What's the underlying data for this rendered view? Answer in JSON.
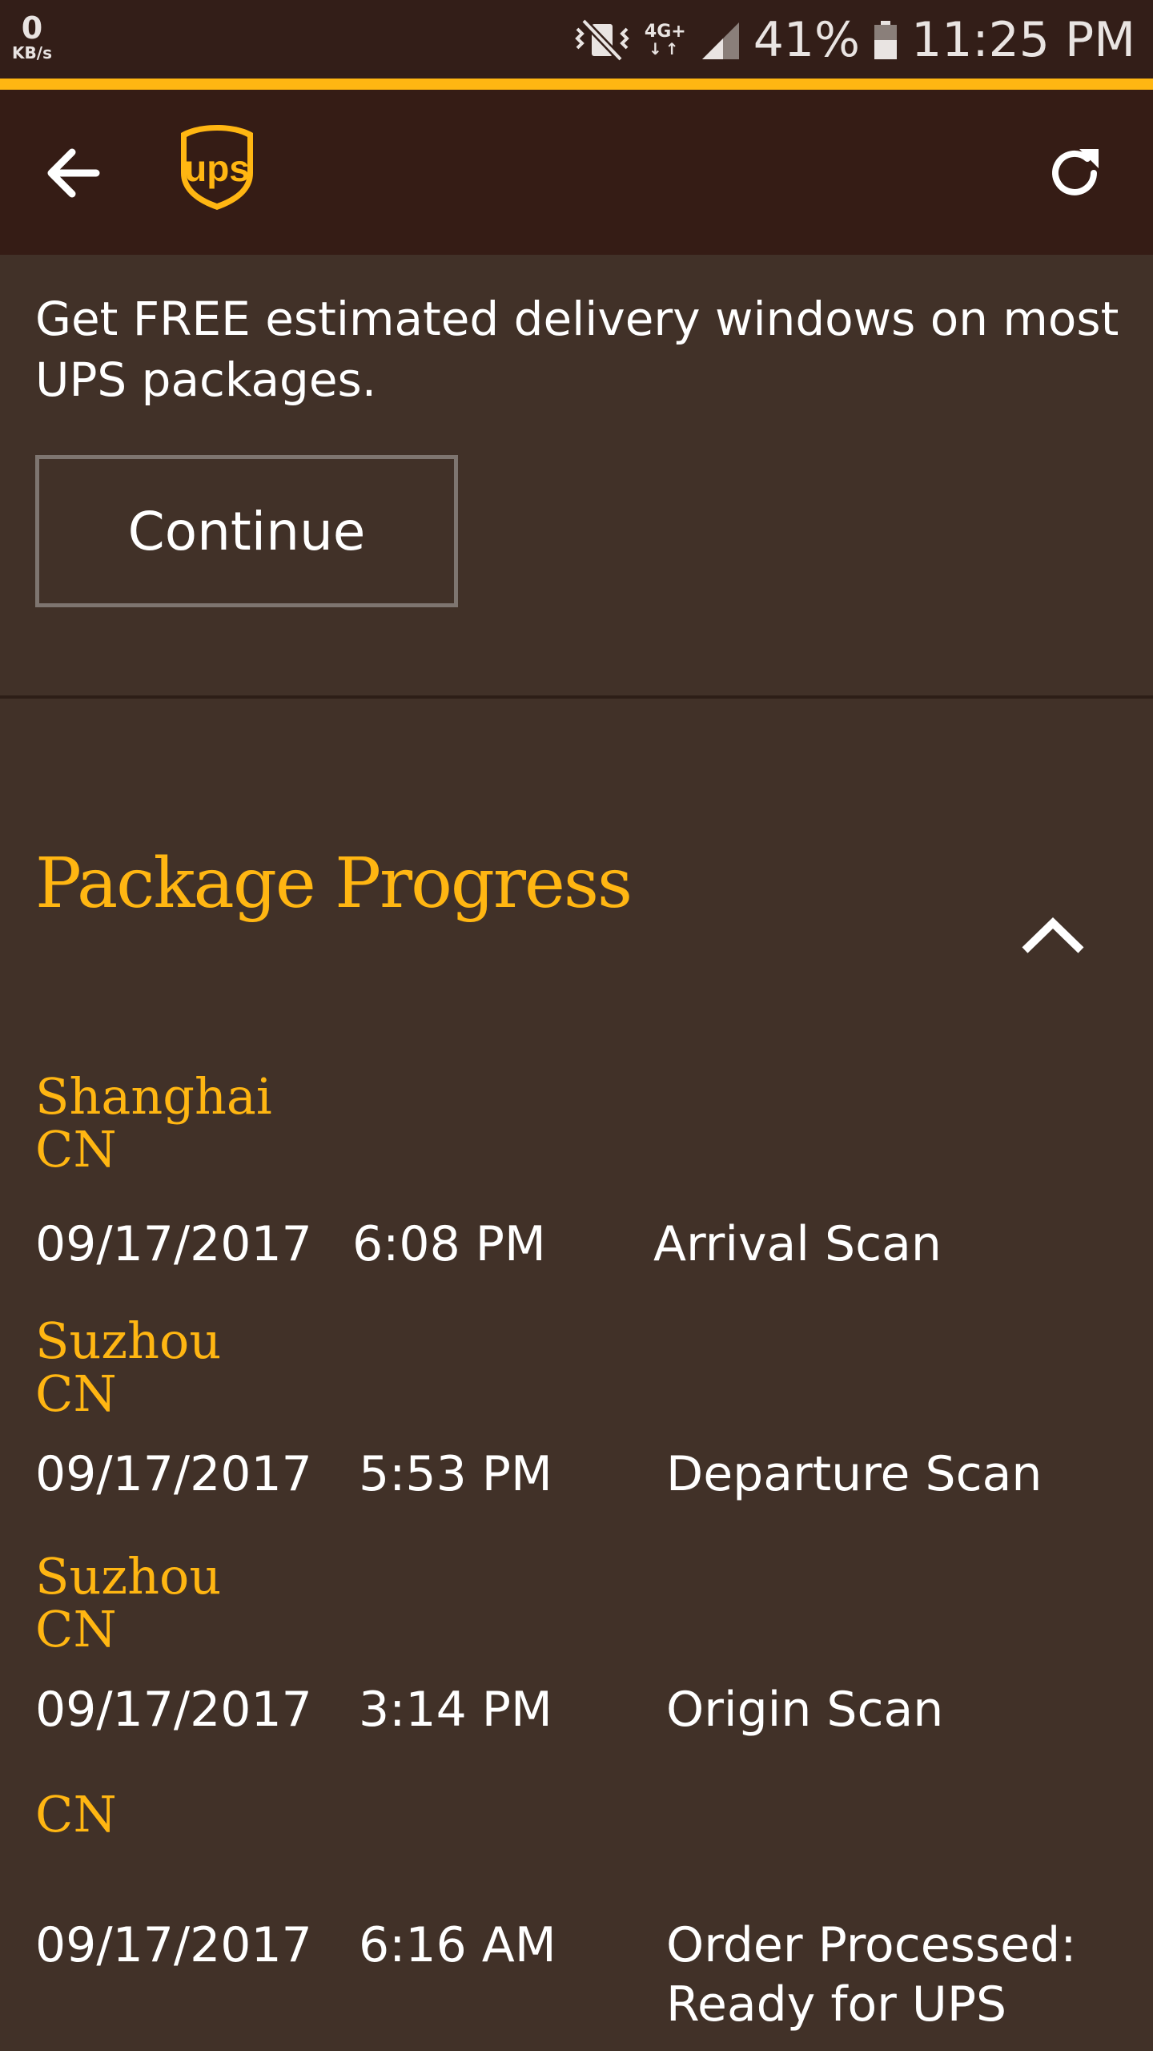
{
  "status_bar": {
    "speed_value": "0",
    "speed_unit": "KB/s",
    "network_type": "4G+",
    "battery_percent": "41%",
    "time": "11:25 PM",
    "icons": [
      "vibrate-mute-icon",
      "lte-data-icon",
      "signal-icon",
      "battery-icon"
    ]
  },
  "app_bar": {
    "back_icon": "arrow-back-icon",
    "logo_text": "ups",
    "refresh_icon": "refresh-icon"
  },
  "promo": {
    "text": "Get FREE estimated delivery windows on most UPS packages.",
    "button_label": "Continue"
  },
  "package_progress": {
    "title": "Package Progress",
    "toggle_icon": "chevron-up-icon",
    "events": [
      {
        "city": "Shanghai",
        "country": "CN",
        "date": "09/17/2017",
        "time": "6:08 PM",
        "activity": "Arrival Scan"
      },
      {
        "city": "Suzhou",
        "country": "CN",
        "date": "09/17/2017",
        "time": "5:53 PM",
        "activity": "Departure Scan"
      },
      {
        "city": "Suzhou",
        "country": "CN",
        "date": "09/17/2017",
        "time": "3:14 PM",
        "activity": "Origin Scan"
      },
      {
        "city": "",
        "country": "CN",
        "date": "09/17/2017",
        "time": "6:16 AM",
        "activity": "Order Processed: Ready for UPS"
      }
    ]
  },
  "colors": {
    "accent": "#ffb612",
    "app_bar_bg": "#351c15",
    "content_bg": "#413128",
    "status_bar_bg": "#331e18"
  }
}
